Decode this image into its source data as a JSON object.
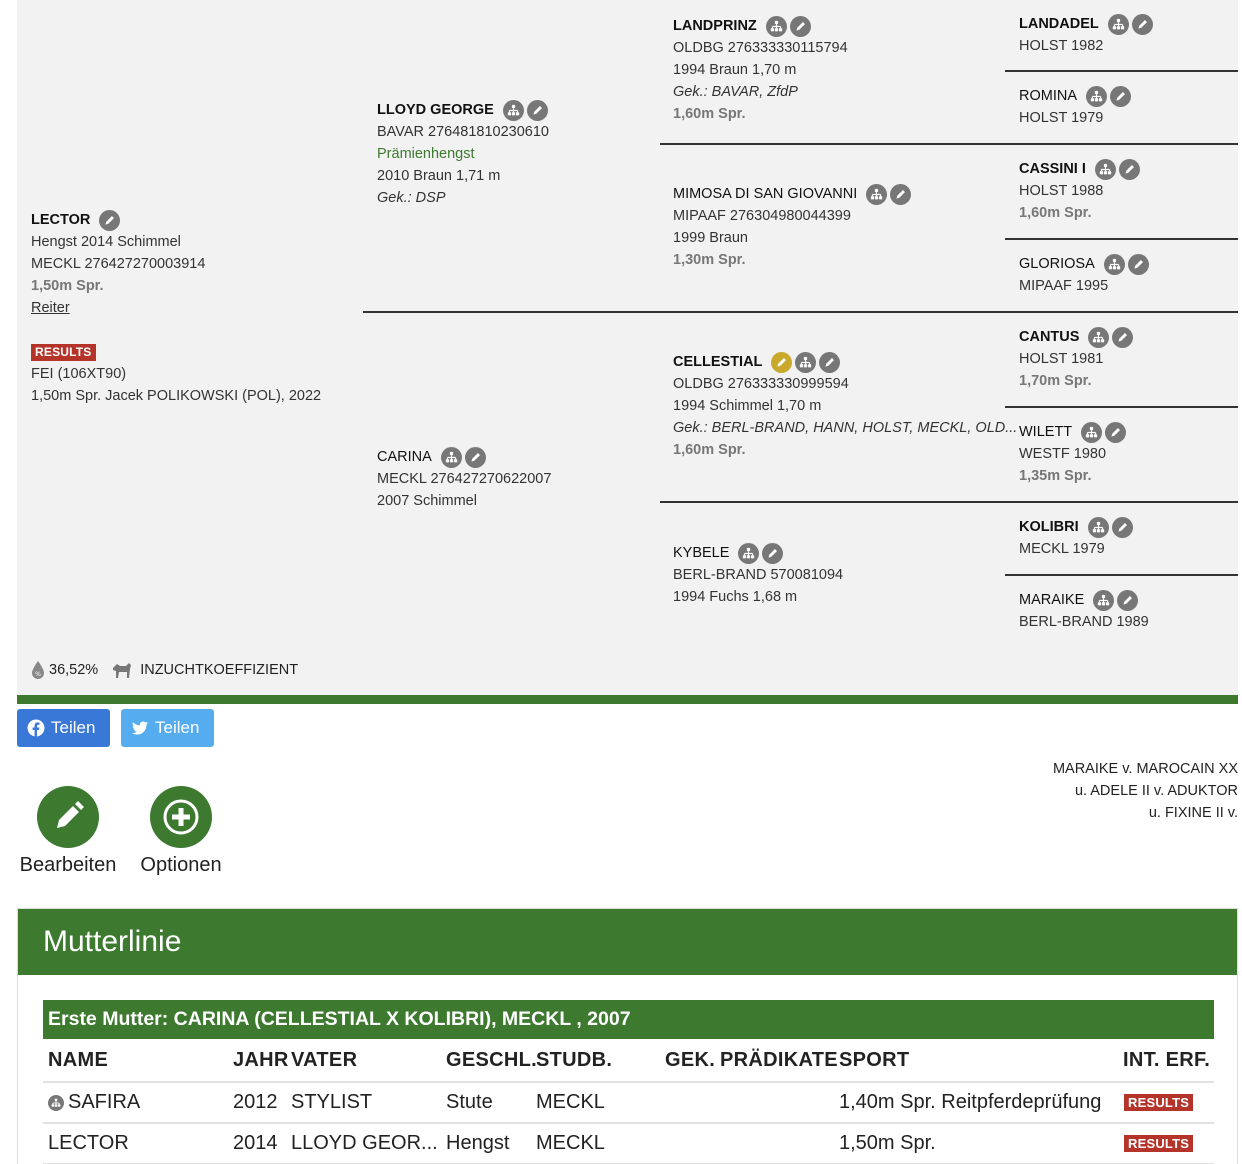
{
  "pedigree": {
    "subject": {
      "name": "LECTOR",
      "line1": "Hengst 2014 Schimmel",
      "line2": "MECKL 276427270003914",
      "sport": "1,50m Spr.",
      "link": "Reiter",
      "results_badge": "RESULTS",
      "results_line1": "FEI (106XT90)",
      "results_line2": "1,50m Spr. Jacek POLIKOWSKI (POL), 2022"
    },
    "sire": {
      "name": "LLOYD GEORGE",
      "line1": "BAVAR 276481810230610",
      "praedikat": "Prämienhengst",
      "line2": "2010 Braun 1,71 m",
      "gek": "Gek.: DSP"
    },
    "dam": {
      "name": "CARINA",
      "line1": "MECKL 276427270622007",
      "line2": "2007 Schimmel"
    },
    "sire_sire": {
      "name": "LANDPRINZ",
      "line1": "OLDBG 276333330115794",
      "line2": "1994 Braun 1,70 m",
      "gek": "Gek.: BAVAR, ZfdP",
      "sport": "1,60m Spr."
    },
    "sire_dam": {
      "name": "MIMOSA DI SAN GIOVANNI",
      "line1": "MIPAAF 276304980044399",
      "line2": "1999 Braun",
      "sport": "1,30m Spr."
    },
    "dam_sire": {
      "name": "CELLESTIAL",
      "line1": "OLDBG 276333330999594",
      "line2": "1994 Schimmel 1,70 m",
      "gek": "Gek.: BERL-BRAND, HANN, HOLST, MECKL, OLD...",
      "sport": "1,60m Spr."
    },
    "dam_dam": {
      "name": "KYBELE",
      "line1": "BERL-BRAND 570081094",
      "line2": "1994 Fuchs 1,68 m"
    },
    "gen4": [
      {
        "name": "LANDADEL",
        "line1": "HOLST 1982",
        "sport": ""
      },
      {
        "name": "ROMINA",
        "line1": "HOLST 1979",
        "sport": ""
      },
      {
        "name": "CASSINI I",
        "line1": "HOLST 1988",
        "sport": "1,60m Spr."
      },
      {
        "name": "GLORIOSA",
        "line1": "MIPAAF 1995",
        "sport": ""
      },
      {
        "name": "CANTUS",
        "line1": "HOLST 1981",
        "sport": "1,70m Spr."
      },
      {
        "name": "WILETT",
        "line1": "WESTF 1980",
        "sport": "1,35m Spr."
      },
      {
        "name": "KOLIBRI",
        "line1": "MECKL 1979",
        "sport": ""
      },
      {
        "name": "MARAIKE",
        "line1": "BERL-BRAND 1989",
        "sport": ""
      }
    ],
    "inbreeding": {
      "percent": "36,52%",
      "label": "INZUCHTKOEFFIZIENT"
    }
  },
  "share": {
    "facebook_label": "Teilen",
    "twitter_label": "Teilen"
  },
  "actions": {
    "edit_label": "Bearbeiten",
    "options_label": "Optionen"
  },
  "maternal_line_text": [
    "MARAIKE v. MAROCAIN XX",
    "u. ADELE II v. ADUKTOR",
    "u. FIXINE II v."
  ],
  "mutterlinie": {
    "title": "Mutterlinie",
    "first_mother": "Erste Mutter: CARINA (CELLESTIAL X KOLIBRI), MECKL , 2007",
    "columns": {
      "name": "NAME",
      "jahr": "JAHR",
      "vater": "VATER",
      "geschl": "GESCHL.",
      "studb": "STUDB.",
      "gek": "GEK.",
      "praed": "PRÄDIKATE",
      "sport": "SPORT",
      "int": "INT. ERF."
    },
    "rows": [
      {
        "name": "SAFIRA",
        "jahr": "2012",
        "vater": "STYLIST",
        "geschl": "Stute",
        "studb": "MECKL",
        "gek": "",
        "praed": "",
        "sport": "1,40m Spr. Reitpferdeprüfung",
        "int": "RESULTS"
      },
      {
        "name": "LECTOR",
        "jahr": "2014",
        "vater": "LLOYD GEOR...",
        "geschl": "Hengst",
        "studb": "MECKL",
        "gek": "",
        "praed": "",
        "sport": "1,50m Spr.",
        "int": "RESULTS"
      }
    ]
  }
}
